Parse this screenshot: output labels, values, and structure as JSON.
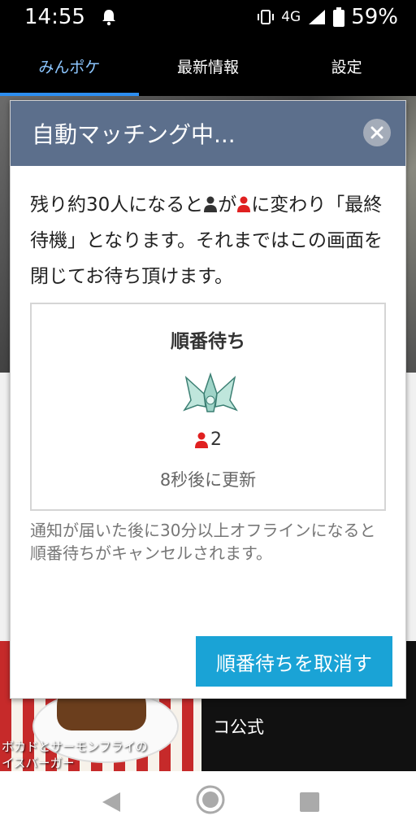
{
  "status_bar": {
    "time": "14:55",
    "network": "4G",
    "battery": "59%",
    "icons": [
      "bell-icon",
      "vibrate-icon",
      "signal-icon",
      "battery-icon"
    ]
  },
  "tabs": [
    {
      "label": "みんポケ",
      "active": true
    },
    {
      "label": "最新情報",
      "active": false
    },
    {
      "label": "設定",
      "active": false
    }
  ],
  "background": {
    "food_caption": "ボカドとサーモンフライの\nイスバーガー",
    "right_caption": "コ公式"
  },
  "modal": {
    "title": "自動マッチング中...",
    "intro_part1": "残り約30人になると",
    "intro_part2": "が",
    "intro_part3": "に変わり「最終待機」となります。それまではこの画面を閉じてお待ち頂けます。",
    "queue_title": "順番待ち",
    "queue_count": "2",
    "refresh_text": "8秒後に更新",
    "notice": "通知が届いた後に30分以上オフラインになると順番待ちがキャンセルされます。",
    "cancel_label": "順番待ちを取消す"
  },
  "colors": {
    "header": "#5c6f8c",
    "accent": "#1aa3d6",
    "active_tab": "#8cc6ff",
    "person_red": "#e02020",
    "person_dark": "#333333"
  }
}
